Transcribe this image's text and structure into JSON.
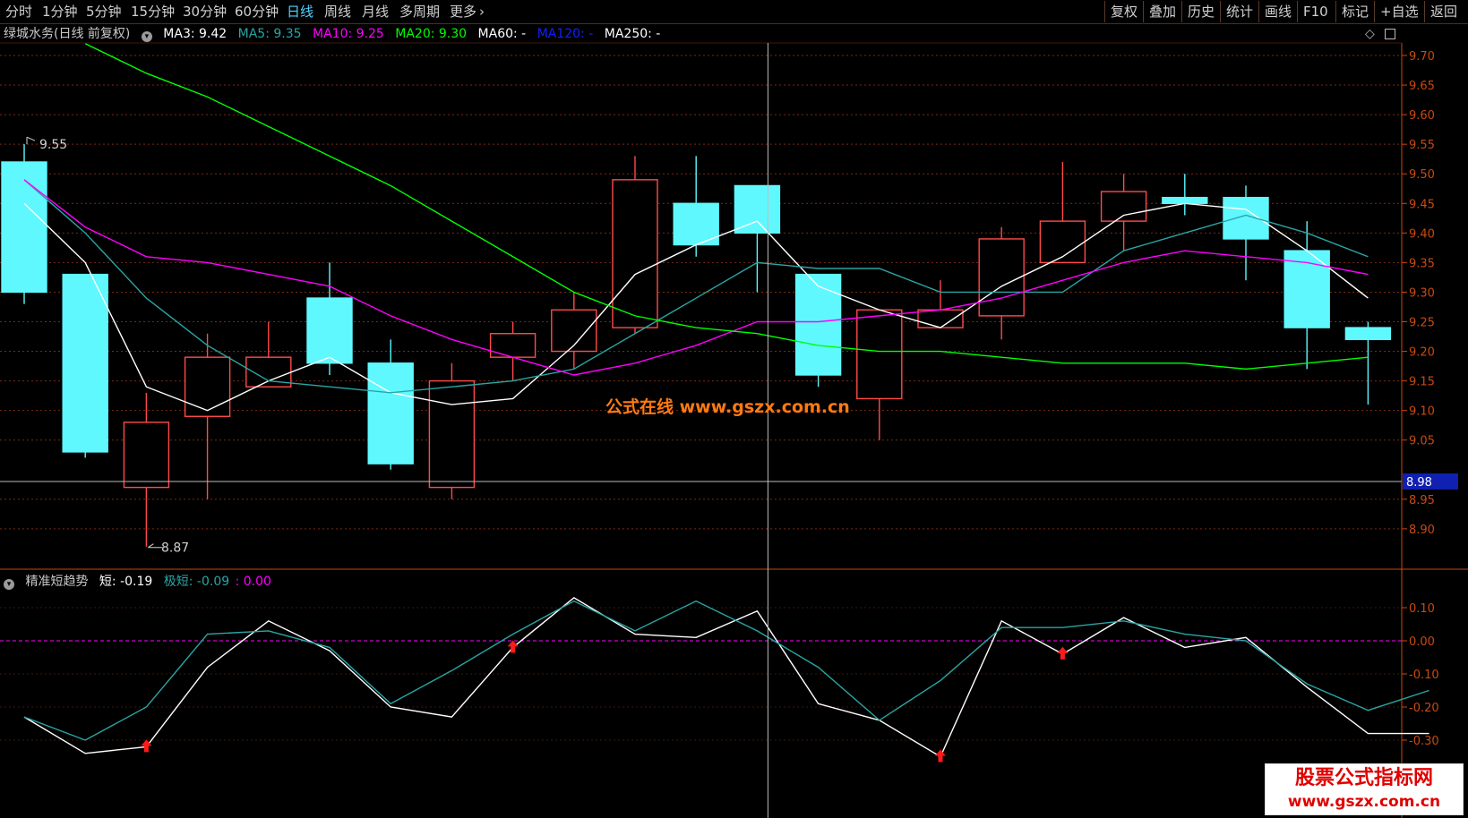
{
  "toolbar": {
    "periods": [
      "分时",
      "1分钟",
      "5分钟",
      "15分钟",
      "30分钟",
      "60分钟",
      "日线",
      "周线",
      "月线",
      "多周期",
      "更多"
    ],
    "active_period": "日线",
    "right_buttons": [
      "复权",
      "叠加",
      "历史",
      "统计",
      "画线",
      "F10",
      "标记",
      "+自选",
      "返回"
    ]
  },
  "main_legend": {
    "stock_title": "绿城水务(日线 前复权)",
    "items": [
      {
        "label": "MA3: 9.42",
        "color": "#ffffff"
      },
      {
        "label": "MA5: 9.35",
        "color": "#2aa5a5"
      },
      {
        "label": "MA10: 9.25",
        "color": "#ff00ff"
      },
      {
        "label": "MA20: 9.30",
        "color": "#00ff00"
      },
      {
        "label": "MA60: -",
        "color": "#ffffff"
      },
      {
        "label": "MA120: -",
        "color": "#1020ff"
      },
      {
        "label": "MA250: -",
        "color": "#ffffff"
      }
    ]
  },
  "sub_legend": {
    "title": "精准短趋势",
    "items": [
      {
        "label": "短: -0.19",
        "color": "#ffffff"
      },
      {
        "label": "极短: -0.09",
        "color": "#2aa5a5"
      },
      {
        "label": ": 0.00",
        "color": "#ff00ff"
      }
    ]
  },
  "watermark": "公式在线  www.gszx.com.cn",
  "badge": {
    "line1": "股票公式指标网",
    "line2": "www.gszx.com.cn"
  },
  "crosshair_price": "8.98",
  "colors": {
    "up": "#ff4a4a",
    "down": "#5ff8ff",
    "axis": "#c84a10",
    "grid": "#7a2a10"
  },
  "chart_data": [
    {
      "type": "candlestick",
      "ylim": [
        8.85,
        9.73
      ],
      "yticks": [
        "9.70",
        "9.65",
        "9.60",
        "9.55",
        "9.50",
        "9.45",
        "9.40",
        "9.35",
        "9.30",
        "9.25",
        "9.20",
        "9.15",
        "9.10",
        "9.05",
        "8.95",
        "8.90"
      ],
      "high_label": "9.55",
      "low_label": "8.87",
      "candles": [
        {
          "o": 9.52,
          "h": 9.55,
          "l": 9.28,
          "c": 9.3
        },
        {
          "o": 9.33,
          "h": 9.33,
          "l": 9.02,
          "c": 9.03
        },
        {
          "o": 8.97,
          "h": 9.13,
          "l": 8.87,
          "c": 9.08
        },
        {
          "o": 9.09,
          "h": 9.23,
          "l": 8.95,
          "c": 9.19
        },
        {
          "o": 9.14,
          "h": 9.25,
          "l": 9.14,
          "c": 9.19
        },
        {
          "o": 9.29,
          "h": 9.35,
          "l": 9.16,
          "c": 9.18
        },
        {
          "o": 9.18,
          "h": 9.22,
          "l": 9.0,
          "c": 9.01
        },
        {
          "o": 8.97,
          "h": 9.18,
          "l": 8.95,
          "c": 9.15
        },
        {
          "o": 9.19,
          "h": 9.25,
          "l": 9.15,
          "c": 9.23
        },
        {
          "o": 9.2,
          "h": 9.3,
          "l": 9.17,
          "c": 9.27
        },
        {
          "o": 9.24,
          "h": 9.53,
          "l": 9.23,
          "c": 9.49
        },
        {
          "o": 9.45,
          "h": 9.53,
          "l": 9.36,
          "c": 9.38
        },
        {
          "o": 9.48,
          "h": 9.48,
          "l": 9.3,
          "c": 9.4
        },
        {
          "o": 9.33,
          "h": 9.33,
          "l": 9.14,
          "c": 9.16
        },
        {
          "o": 9.12,
          "h": 9.27,
          "l": 9.05,
          "c": 9.27
        },
        {
          "o": 9.24,
          "h": 9.32,
          "l": 9.24,
          "c": 9.27
        },
        {
          "o": 9.26,
          "h": 9.41,
          "l": 9.22,
          "c": 9.39
        },
        {
          "o": 9.35,
          "h": 9.52,
          "l": 9.35,
          "c": 9.42
        },
        {
          "o": 9.42,
          "h": 9.5,
          "l": 9.37,
          "c": 9.47
        },
        {
          "o": 9.46,
          "h": 9.5,
          "l": 9.43,
          "c": 9.45
        },
        {
          "o": 9.46,
          "h": 9.48,
          "l": 9.32,
          "c": 9.39
        },
        {
          "o": 9.37,
          "h": 9.42,
          "l": 9.17,
          "c": 9.24
        },
        {
          "o": 9.24,
          "h": 9.25,
          "l": 9.11,
          "c": 9.22
        }
      ],
      "series": [
        {
          "name": "MA3",
          "color": "#ffffff",
          "values": [
            9.45,
            9.35,
            9.14,
            9.1,
            9.15,
            9.19,
            9.13,
            9.11,
            9.12,
            9.21,
            9.33,
            9.38,
            9.42,
            9.31,
            9.27,
            9.24,
            9.31,
            9.36,
            9.43,
            9.45,
            9.44,
            9.37,
            9.29
          ]
        },
        {
          "name": "MA5",
          "color": "#2aa5a5",
          "values": [
            9.49,
            9.4,
            9.29,
            9.21,
            9.15,
            9.14,
            9.13,
            9.14,
            9.15,
            9.17,
            9.23,
            9.29,
            9.35,
            9.34,
            9.34,
            9.3,
            9.3,
            9.3,
            9.37,
            9.4,
            9.43,
            9.4,
            9.36
          ]
        },
        {
          "name": "MA10",
          "color": "#ff00ff",
          "values": [
            9.49,
            9.41,
            9.36,
            9.35,
            9.33,
            9.31,
            9.26,
            9.22,
            9.19,
            9.16,
            9.18,
            9.21,
            9.25,
            9.25,
            9.26,
            9.27,
            9.29,
            9.32,
            9.35,
            9.37,
            9.36,
            9.35,
            9.33
          ]
        },
        {
          "name": "MA20",
          "color": "#00ff00",
          "x_start": 1,
          "values": [
            9.72,
            9.67,
            9.63,
            9.58,
            9.53,
            9.48,
            9.42,
            9.36,
            9.3,
            9.26,
            9.24,
            9.23,
            9.21,
            9.2,
            9.2,
            9.19,
            9.18,
            9.18,
            9.18,
            9.17,
            9.18,
            9.19
          ]
        }
      ]
    },
    {
      "type": "line",
      "ylim": [
        -0.38,
        0.14
      ],
      "yticks": [
        "0.10",
        "0.00",
        "-0.10",
        "-0.20",
        "-0.30"
      ],
      "series": [
        {
          "name": "短",
          "color": "#ffffff",
          "values": [
            -0.23,
            -0.34,
            -0.32,
            -0.08,
            0.06,
            -0.03,
            -0.2,
            -0.23,
            -0.02,
            0.13,
            0.02,
            0.01,
            0.09,
            -0.19,
            -0.24,
            -0.35,
            0.06,
            -0.04,
            0.07,
            -0.02,
            0.01,
            -0.14,
            -0.28,
            -0.28
          ]
        },
        {
          "name": "极短",
          "color": "#2aa5a5",
          "values": [
            -0.23,
            -0.3,
            -0.2,
            0.02,
            0.03,
            -0.02,
            -0.19,
            -0.09,
            0.02,
            0.12,
            0.03,
            0.12,
            0.03,
            -0.08,
            -0.24,
            -0.12,
            0.04,
            0.04,
            0.06,
            0.02,
            0.0,
            -0.13,
            -0.21,
            -0.15
          ]
        },
        {
          "name": ":",
          "color": "#ff00ff",
          "values": [
            0.0,
            0.0
          ]
        }
      ],
      "buy_signals": [
        2,
        8,
        15,
        17
      ],
      "crosshair_index": 12
    }
  ]
}
